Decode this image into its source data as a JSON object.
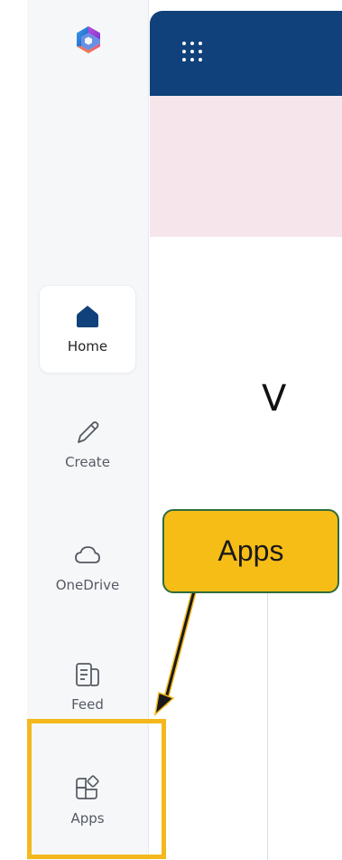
{
  "rail": {
    "items": [
      {
        "id": "home",
        "label": "Home",
        "icon": "home-icon",
        "active": true
      },
      {
        "id": "create",
        "label": "Create",
        "icon": "pen-icon"
      },
      {
        "id": "onedrive",
        "label": "OneDrive",
        "icon": "cloud-icon"
      },
      {
        "id": "feed",
        "label": "Feed",
        "icon": "feed-icon"
      },
      {
        "id": "apps",
        "label": "Apps",
        "icon": "apps-icon"
      }
    ]
  },
  "header": {
    "launcher_icon": "waffle-icon"
  },
  "content": {
    "partial_heading": "V"
  },
  "annotation": {
    "callout_text": "Apps",
    "highlight_target": "Apps",
    "colors": {
      "callout_fill": "#f7bd17",
      "callout_border": "#2f6b3b",
      "highlight": "#f4b81d",
      "arrow": "#1a1a1a"
    }
  },
  "colors": {
    "header_bg": "#10417a",
    "banner_bg": "#f6e6ec",
    "rail_bg": "#f6f7f9",
    "home_icon": "#10417a"
  }
}
